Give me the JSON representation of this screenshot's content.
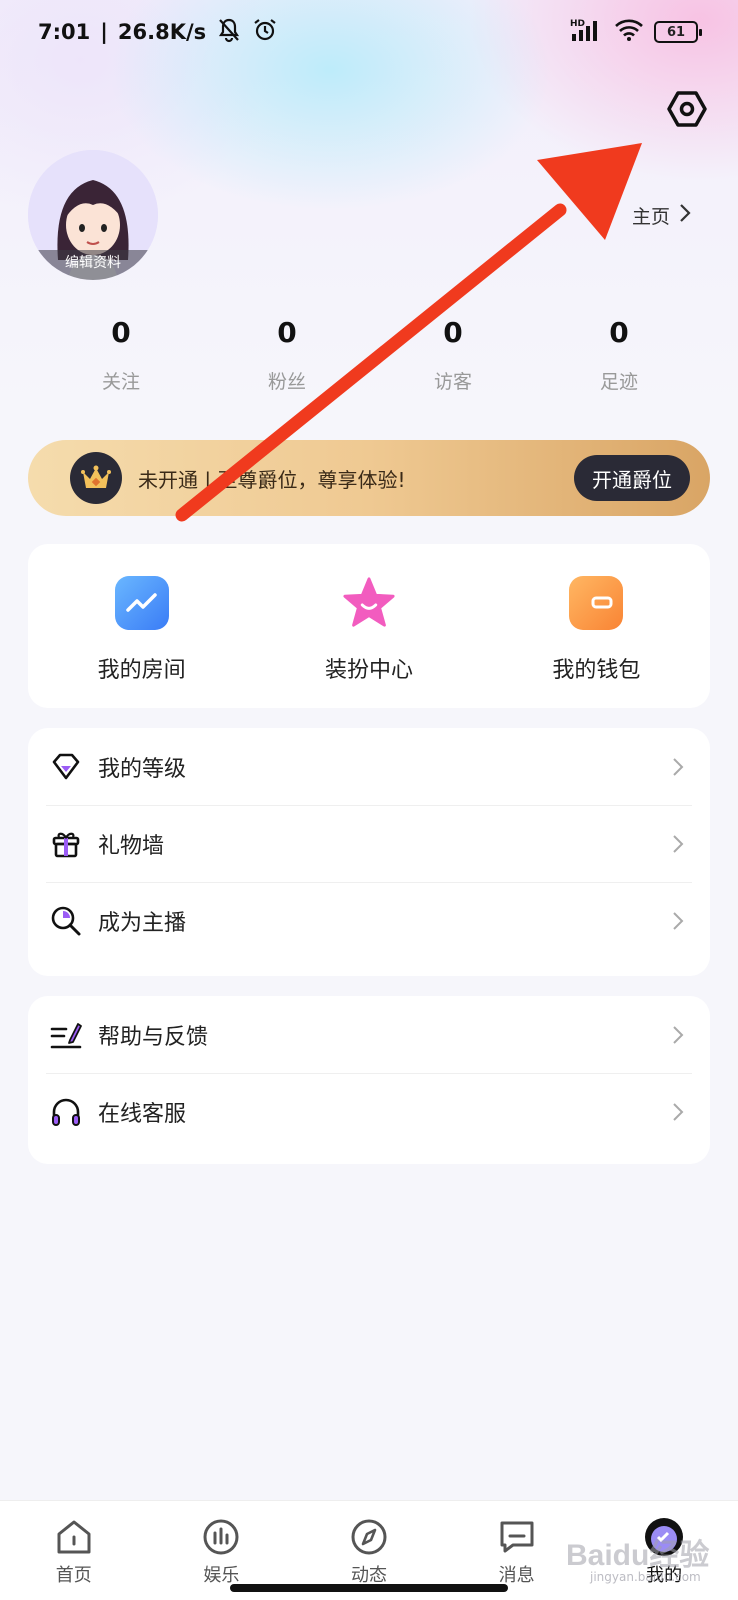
{
  "status_bar": {
    "time": "7:01",
    "separator": "|",
    "speed": "26.8K/s",
    "battery": "61",
    "signal_label": "HD"
  },
  "header": {
    "home_link": "主页"
  },
  "profile": {
    "edit_label": "编辑资料"
  },
  "stats": [
    {
      "value": "0",
      "label": "关注"
    },
    {
      "value": "0",
      "label": "粉丝"
    },
    {
      "value": "0",
      "label": "访客"
    },
    {
      "value": "0",
      "label": "足迹"
    }
  ],
  "vip": {
    "text": "未开通 | 至尊爵位，尊享体验!",
    "button": "开通爵位"
  },
  "quick_actions": [
    {
      "label": "我的房间",
      "icon": "chart-room-icon"
    },
    {
      "label": "装扮中心",
      "icon": "star-icon"
    },
    {
      "label": "我的钱包",
      "icon": "wallet-icon"
    }
  ],
  "menu_group1": [
    {
      "label": "我的等级",
      "icon": "diamond-icon"
    },
    {
      "label": "礼物墙",
      "icon": "gift-icon"
    },
    {
      "label": "成为主播",
      "icon": "magnifier-icon"
    }
  ],
  "menu_group2": [
    {
      "label": "帮助与反馈",
      "icon": "edit-feedback-icon"
    },
    {
      "label": "在线客服",
      "icon": "headphones-icon"
    }
  ],
  "tabs": [
    {
      "label": "首页",
      "icon": "home-icon"
    },
    {
      "label": "娱乐",
      "icon": "entertainment-icon"
    },
    {
      "label": "动态",
      "icon": "compass-icon"
    },
    {
      "label": "消息",
      "icon": "message-icon"
    },
    {
      "label": "我的",
      "icon": "profile-icon",
      "active": true
    }
  ],
  "watermark": {
    "text": "Baidu经验",
    "sub": "jingyan.baidu.com"
  },
  "colors": {
    "annotation_arrow": "#f03a1e",
    "vip_gold": "#efc992",
    "vip_dark": "#2a2a36"
  }
}
